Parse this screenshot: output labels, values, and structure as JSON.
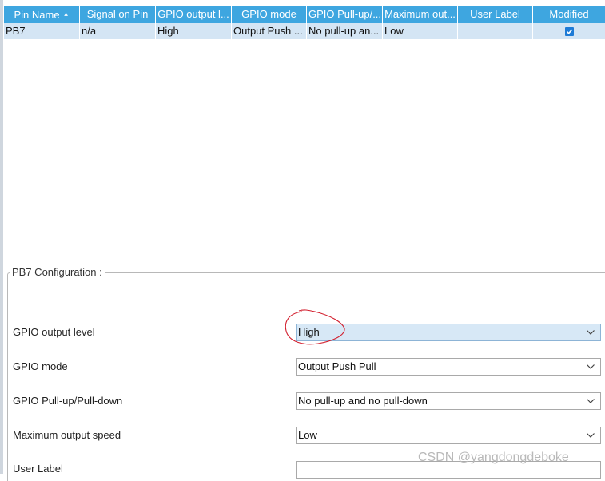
{
  "table": {
    "columns": [
      "Pin Name",
      "Signal on Pin",
      "GPIO output l...",
      "GPIO mode",
      "GPIO Pull-up/...",
      "Maximum out...",
      "User Label",
      "Modified"
    ],
    "rows": [
      {
        "pin_name": "PB7",
        "signal": "n/a",
        "output_level": "High",
        "mode": "Output Push ...",
        "pull": "No pull-up an...",
        "max_speed": "Low",
        "user_label": "",
        "modified": true
      }
    ]
  },
  "config": {
    "title": "PB7 Configuration :",
    "fields": [
      {
        "label": "GPIO output level",
        "value": "High"
      },
      {
        "label": "GPIO mode",
        "value": "Output Push Pull"
      },
      {
        "label": "GPIO Pull-up/Pull-down",
        "value": "No pull-up and no pull-down"
      },
      {
        "label": "Maximum output speed",
        "value": "Low"
      },
      {
        "label": "User Label",
        "value": ""
      }
    ]
  },
  "watermark": "CSDN @yangdongdeboke",
  "colors": {
    "header": "#3ea6e0",
    "selected_row": "#d4e5f4",
    "annotation": "#d21e2d"
  }
}
